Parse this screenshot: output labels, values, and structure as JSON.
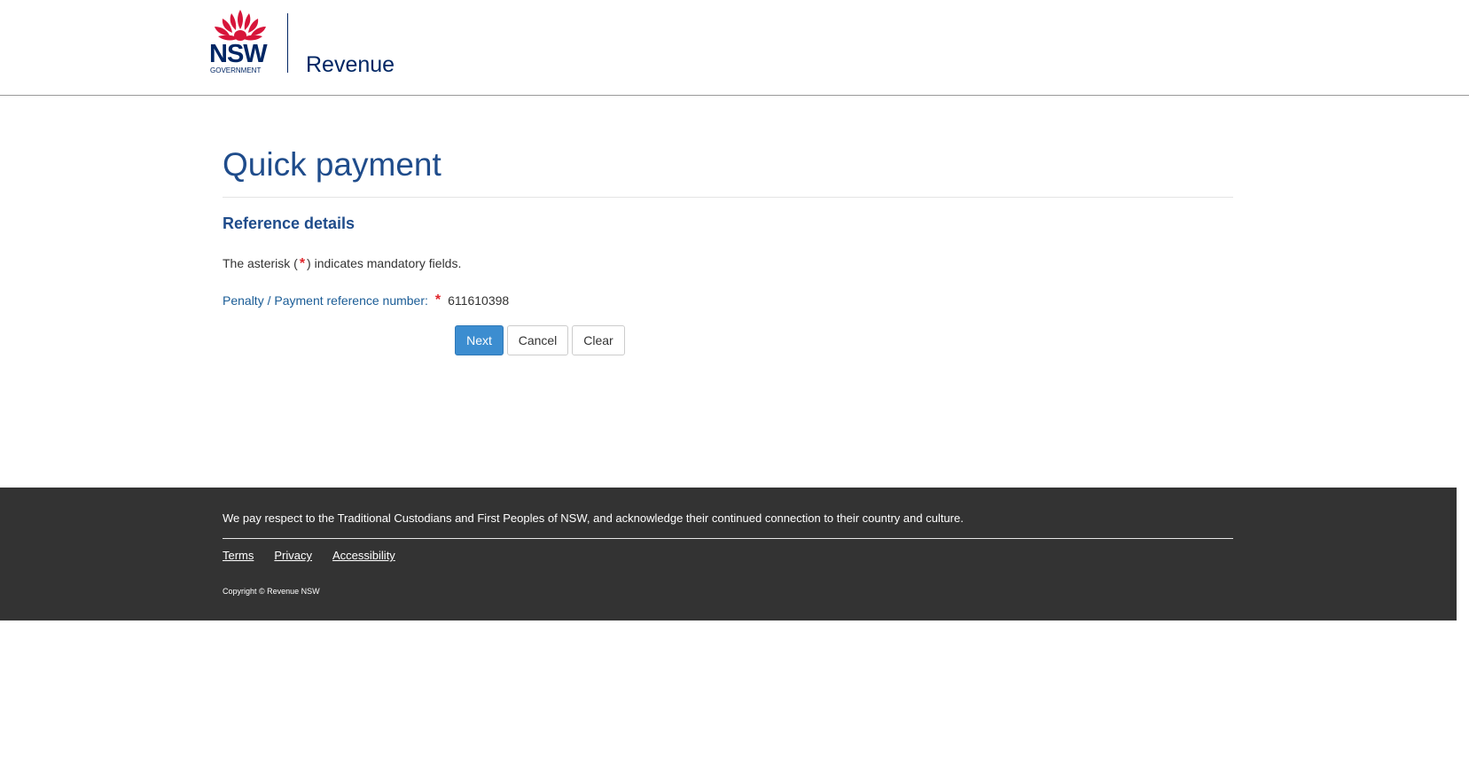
{
  "header": {
    "nsw_logo_text": "NSW",
    "government_text": "GOVERNMENT",
    "brand_name": "Revenue"
  },
  "main": {
    "page_title": "Quick payment",
    "section_title": "Reference details",
    "mandatory_note_prefix": "The asterisk (",
    "mandatory_note_asterisk": "*",
    "mandatory_note_suffix": ") indicates mandatory fields.",
    "reference_field": {
      "label": "Penalty / Payment reference number:",
      "required_marker": "*",
      "value": "611610398"
    },
    "buttons": {
      "next_label": "Next",
      "cancel_label": "Cancel",
      "clear_label": "Clear"
    }
  },
  "footer": {
    "acknowledgement": "We pay respect to the Traditional Custodians and First Peoples of NSW, and acknowledge their continued connection to their country and culture.",
    "links": {
      "terms": "Terms",
      "privacy": "Privacy",
      "accessibility": "Accessibility"
    },
    "copyright": "Copyright © Revenue NSW"
  },
  "colors": {
    "nsw_navy": "#002664",
    "waratah_red": "#d7153a",
    "title_blue": "#1f4c8b",
    "label_blue": "#1a5c96",
    "primary_button": "#3c8dd0",
    "required_red": "#e0252b",
    "footer_bg": "#333333"
  },
  "icons": {
    "logo_emblem": "waratah-icon"
  }
}
